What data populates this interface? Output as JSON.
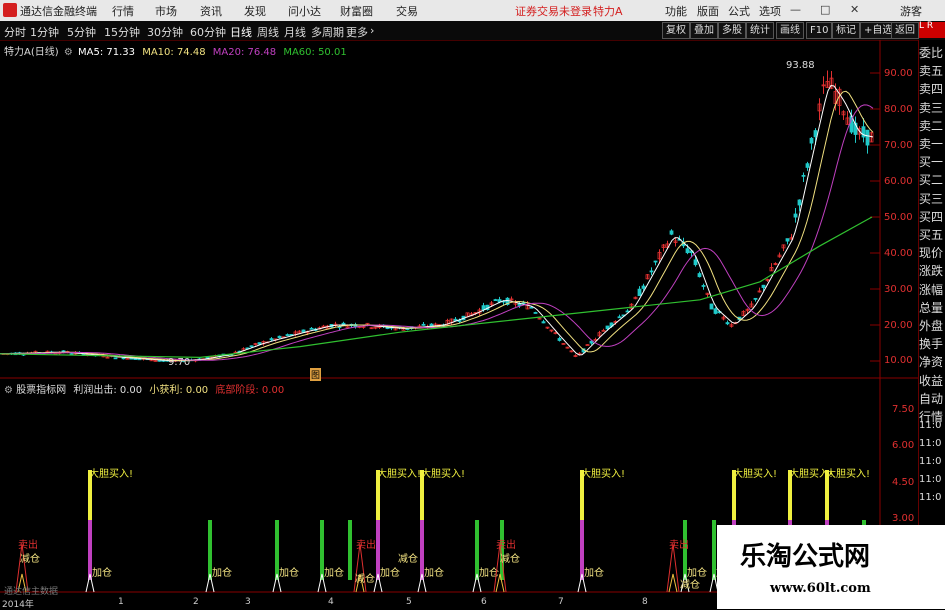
{
  "window": {
    "app_title": "通达信金融终端",
    "menu": [
      "行情",
      "市场",
      "资讯",
      "发现",
      "问小达",
      "财富圈",
      "交易"
    ],
    "warning": "证券交易未登录",
    "stock_title": "特力A",
    "right_menu": [
      "功能",
      "版面",
      "公式",
      "选项"
    ],
    "guest": "游客"
  },
  "period": {
    "items": [
      "分时",
      "1分钟",
      "5分钟",
      "15分钟",
      "30分钟",
      "60分钟",
      "日线",
      "周线",
      "月线",
      "多周期",
      "更多"
    ],
    "selected": "日线"
  },
  "toolbar_right": [
    "复权",
    "叠加",
    "多股",
    "统计",
    "画线",
    "F10",
    "标记",
    "+自选",
    "返回"
  ],
  "main_info": {
    "name": "特力A(日线)",
    "ma5": "MA5: 71.33",
    "ma10": "MA10: 74.48",
    "ma20": "MA20: 76.48",
    "ma60": "MA60: 50.01"
  },
  "annotations": {
    "high": "93.88",
    "low": "9.70",
    "marker": "图"
  },
  "price_axis": [
    "90.00",
    "80.00",
    "70.00",
    "60.00",
    "50.00",
    "40.00",
    "30.00",
    "20.00",
    "10.00"
  ],
  "sub_info": {
    "name": "股票指标网",
    "a": "利润出击: 0.00",
    "b": "小获利: 0.00",
    "c": "底部阶段: 0.00"
  },
  "sub_axis": [
    "7.50",
    "6.00",
    "4.50",
    "3.00"
  ],
  "date_axis": [
    "2014年",
    "1",
    "2",
    "3",
    "4",
    "5",
    "6",
    "7",
    "8"
  ],
  "signal_labels": {
    "buy": "大胆买入!",
    "add": "加仓",
    "reduce": "减仓",
    "sell": "卖出"
  },
  "right_panel": [
    "委比",
    "卖五",
    "卖四",
    "卖三",
    "卖二",
    "卖一",
    "买一",
    "买二",
    "买三",
    "买四",
    "买五",
    "现价",
    "涨跌",
    "涨幅",
    "总量",
    "外盘",
    "换手",
    "净资",
    "收益",
    "自动",
    "行情"
  ],
  "right_times": [
    "11:0",
    "11:0",
    "11:0",
    "11:0",
    "11:0"
  ],
  "bottom_left": "通达信主数据",
  "watermark": {
    "title": "乐淘公式网",
    "url": "www.60lt.com"
  },
  "colors": {
    "up": "#e03030",
    "down": "#20c8c8",
    "ma5": "#ffffff",
    "ma10": "#f0e080",
    "ma20": "#c040c0",
    "ma60": "#30c030"
  }
}
